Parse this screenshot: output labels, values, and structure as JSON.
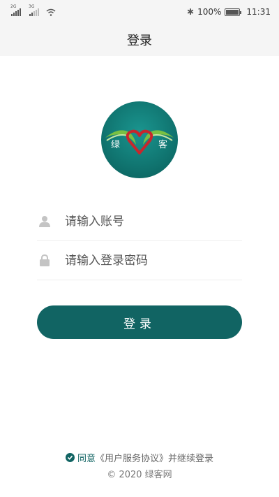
{
  "status_bar": {
    "sim1_label": "2G",
    "sim2_label": "3G",
    "battery": "100%",
    "time": "11:31"
  },
  "header": {
    "title": "登录"
  },
  "logo": {
    "left_char": "绿",
    "right_char": "客"
  },
  "form": {
    "account_placeholder": "请输入账号",
    "password_placeholder": "请输入登录密码",
    "login_label": "登录"
  },
  "footer": {
    "agree_text": "同意",
    "agreement_link": "《用户服务协议》",
    "continue_text": "并继续登录",
    "copyright": "© 2020 绿客网"
  },
  "colors": {
    "primary": "#116463",
    "logo_bg": "#13827d",
    "heart": "#c8262c",
    "leaf": "#79c043"
  }
}
